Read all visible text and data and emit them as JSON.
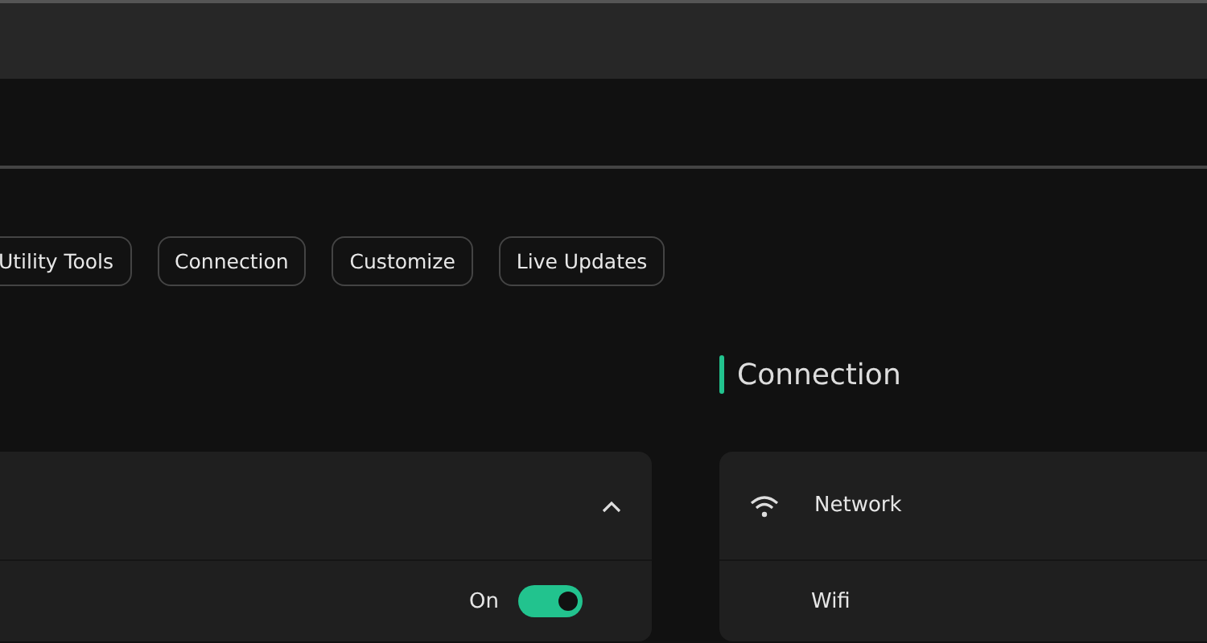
{
  "chips": [
    {
      "label": "Utility Tools"
    },
    {
      "label": "Connection"
    },
    {
      "label": "Customize"
    },
    {
      "label": "Live Updates"
    }
  ],
  "left_card": {
    "expanded": true,
    "rows": [
      {
        "value_label": "On",
        "on": true
      }
    ]
  },
  "section": {
    "title": "Connection"
  },
  "right_card": {
    "header": "Network",
    "rows": [
      {
        "label": "Wifi"
      }
    ]
  }
}
